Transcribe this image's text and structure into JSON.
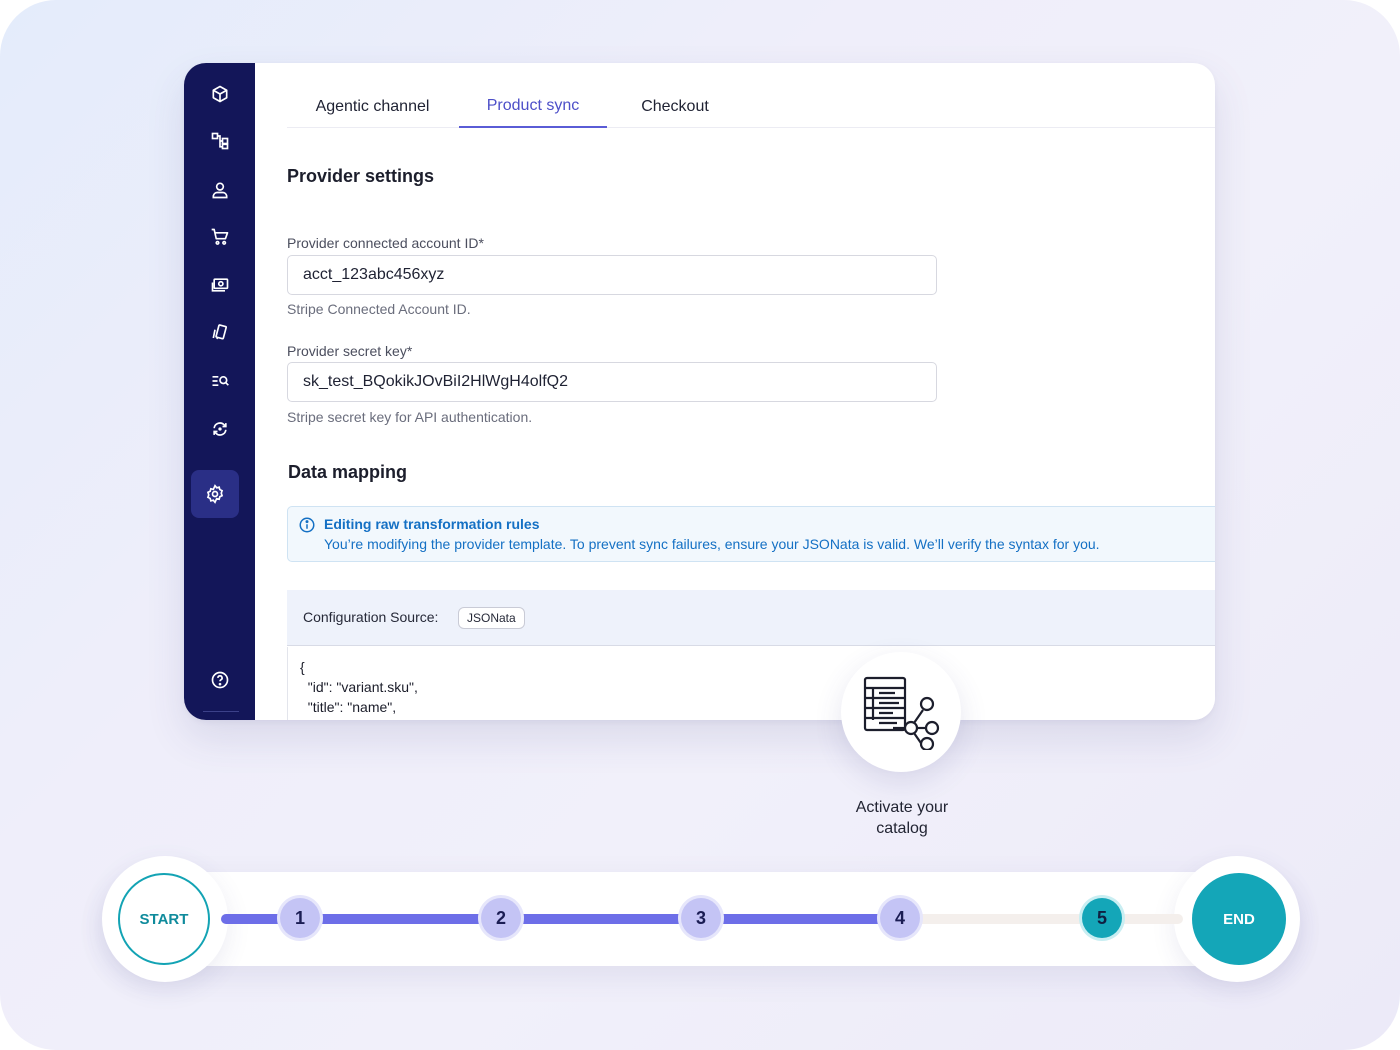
{
  "tabs": [
    {
      "label": "Agentic channel"
    },
    {
      "label": "Product sync",
      "active": true
    },
    {
      "label": "Checkout"
    }
  ],
  "sidebar": {
    "icons": [
      "cube-icon",
      "workflow-icon",
      "user-icon",
      "cart-icon",
      "payments-icon",
      "cards-icon",
      "search-list-icon",
      "sync-icon",
      "settings-icon",
      "help-icon"
    ],
    "active": "settings-icon"
  },
  "provider_settings": {
    "title": "Provider settings",
    "account_id": {
      "label": "Provider connected account ID*",
      "value": "acct_123abc456xyz",
      "help": "Stripe Connected Account ID."
    },
    "secret_key": {
      "label": "Provider secret key*",
      "value": "sk_test_BQokikJOvBiI2HlWgH4olfQ2",
      "help": "Stripe secret key for API authentication."
    }
  },
  "data_mapping": {
    "title": "Data mapping",
    "alert": {
      "title": "Editing raw transformation rules",
      "body": "You’re modifying the provider template. To prevent sync failures, ensure your JSONata is valid. We’ll verify the syntax for you."
    },
    "config_label": "Configuration Source:",
    "config_chip": "JSONata",
    "code": "{\n  \"id\": \"variant.sku\",\n  \"title\": \"name\","
  },
  "step_badge": {
    "icon": "catalog-tree-icon",
    "caption_line1": "Activate your",
    "caption_line2": "catalog"
  },
  "progress": {
    "start_label": "START",
    "end_label": "END",
    "steps": [
      "1",
      "2",
      "3",
      "4",
      "5"
    ],
    "current_step": 5,
    "completed_fraction": 0.75
  },
  "colors": {
    "sidebar": "#131659",
    "accent": "#5a5cd6",
    "teal": "#14a6b8",
    "info": "#1470c4"
  }
}
